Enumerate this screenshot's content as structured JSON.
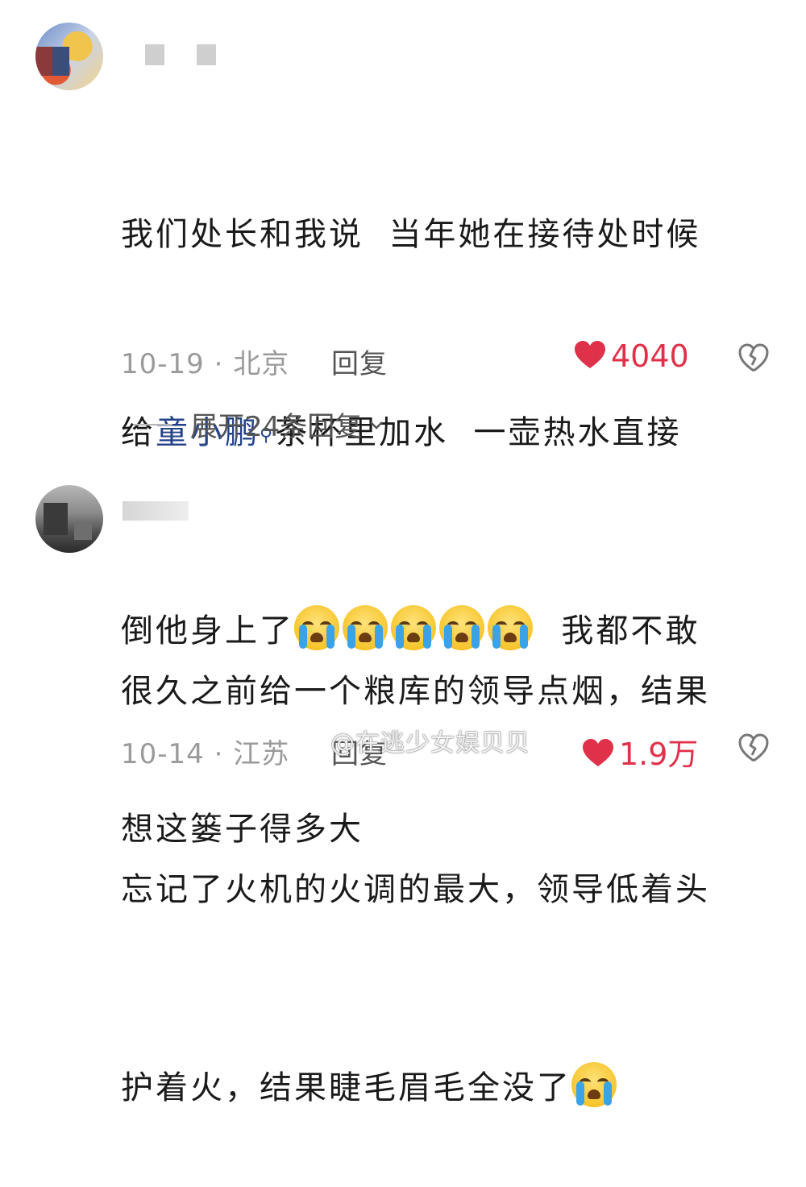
{
  "comments": [
    {
      "lines": [
        {
          "before": "我们处长和我说  当年她在接待处时候"
        },
        {
          "before": "给",
          "topic": "童小鹏",
          "topic_icon": "search-icon",
          "after": "茶杯里加水  一壶热水直接"
        },
        {
          "before": "倒他身上了",
          "emoji_count": 5,
          "after": "  我都不敢"
        },
        {
          "before": "想这篓子得多大"
        }
      ],
      "date": "10-19",
      "location": "北京",
      "reply_label": "回复",
      "likes": "4040",
      "expand_replies": "展开24条回复"
    },
    {
      "lines": [
        {
          "before": "很久之前给一个粮库的领导点烟，结果"
        },
        {
          "before": "忘记了火机的火调的最大，领导低着头"
        },
        {
          "before": "护着火，结果睫毛眉毛全没了",
          "emoji_count": 1
        }
      ],
      "date": "10-14",
      "location": "江苏",
      "reply_label": "回复",
      "likes": "1.9万"
    }
  ],
  "watermark": "@在逃少女娱贝贝",
  "colors": {
    "like": "#e0314a",
    "topic_link": "#24428a",
    "meta": "#9a9a9a"
  }
}
